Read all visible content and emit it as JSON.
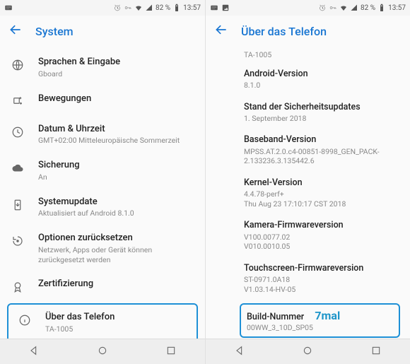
{
  "status": {
    "battery_pct": "82 %",
    "time": "13:57"
  },
  "left": {
    "title": "System",
    "items": [
      {
        "icon": "globe",
        "label": "Sprachen & Eingabe",
        "sub": "Gboard"
      },
      {
        "icon": "sparkle",
        "label": "Bewegungen",
        "sub": ""
      },
      {
        "icon": "clock",
        "label": "Datum & Uhrzeit",
        "sub": "GMT+02:00 Mitteleuropäische Sommerzeit"
      },
      {
        "icon": "cloud",
        "label": "Sicherung",
        "sub": "An"
      },
      {
        "icon": "phone-update",
        "label": "Systemupdate",
        "sub": "Aktualisiert auf Android 8.1.0"
      },
      {
        "icon": "reset",
        "label": "Optionen zurücksetzen",
        "sub": "Netzwerk, Apps oder Gerät können zurückgesetzt werden"
      },
      {
        "icon": "ribbon",
        "label": "Zertifizierung",
        "sub": ""
      },
      {
        "icon": "info",
        "label": "Über das Telefon",
        "sub": "TA-1005",
        "highlight": true
      }
    ]
  },
  "right": {
    "title": "Über das Telefon",
    "top_stub": "TA-1005",
    "items": [
      {
        "label": "Android-Version",
        "sub": "8.1.0"
      },
      {
        "label": "Stand der Sicherheitsupdates",
        "sub": "1. September 2018"
      },
      {
        "label": "Baseband-Version",
        "sub": "MPSS.AT.2.0.c4-00851-8998_GEN_PACK-2.133236.3.135442.6"
      },
      {
        "label": "Kernel-Version",
        "sub": "4.4.78-perf+\nThu Aug 23 17:10:17 CST 2018"
      },
      {
        "label": "Kamera-Firmwareversion",
        "sub": "V100.0077.02\nV010.0010.05"
      },
      {
        "label": "Touchscreen-Firmwareversion",
        "sub": "ST-0971.0A18\nV1.03.14-HV-05"
      }
    ],
    "build": {
      "label": "Build-Nummer",
      "sub": "00WW_3_10D_SP05",
      "annotation": "7mal"
    }
  }
}
